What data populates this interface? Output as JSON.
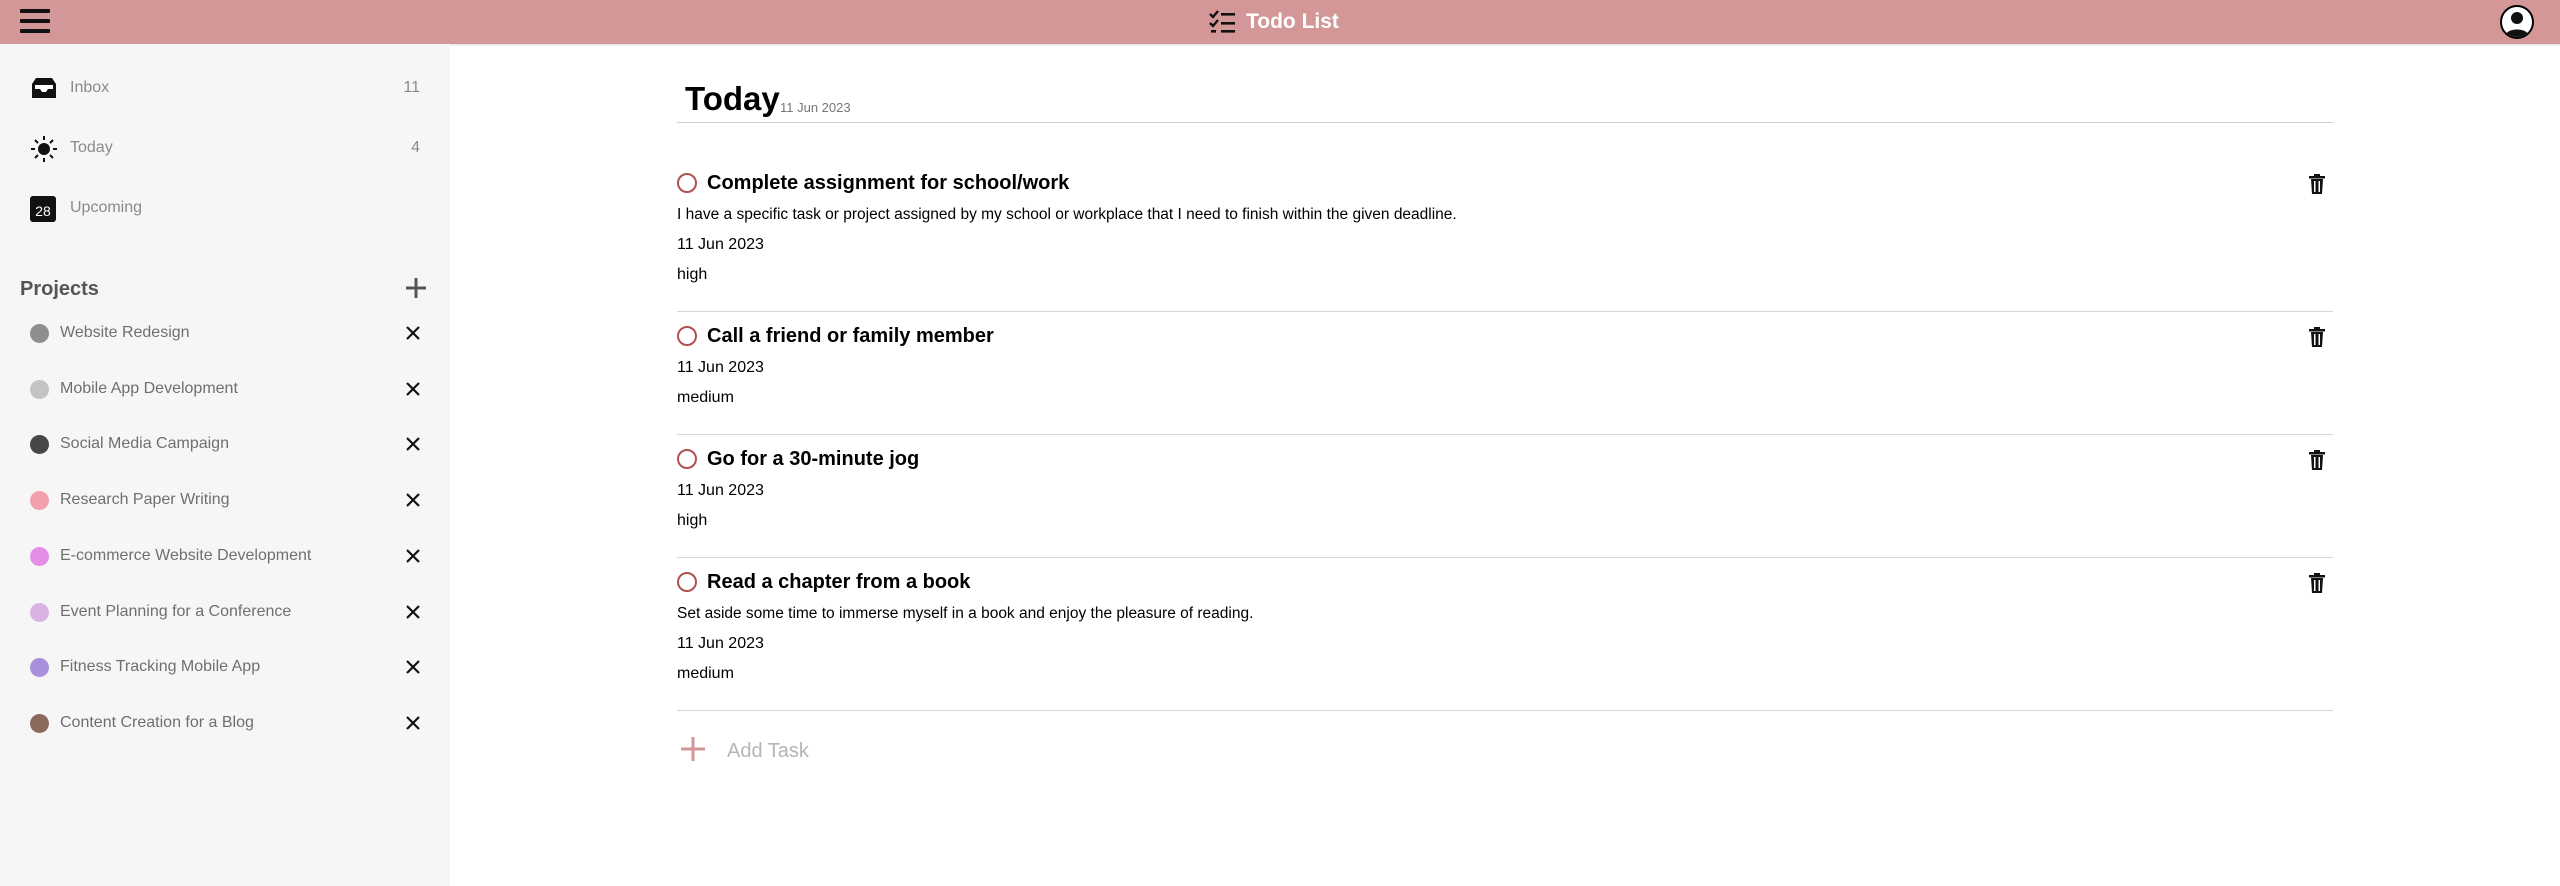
{
  "header": {
    "title": "Todo List",
    "brand_color": "#d39797",
    "menu_icon": "hamburger-icon",
    "brand_icon": "checklist-icon",
    "avatar_icon": "user-avatar-icon"
  },
  "sidebar": {
    "nav": [
      {
        "label": "Inbox",
        "count": "11",
        "icon": "inbox-icon"
      },
      {
        "label": "Today",
        "count": "4",
        "icon": "sun-icon"
      },
      {
        "label": "Upcoming",
        "count": "",
        "icon": "calendar-icon",
        "calendar_day": "28"
      }
    ],
    "projects_title": "Projects",
    "projects": [
      {
        "name": "Website Redesign",
        "color": "#8e8e8e"
      },
      {
        "name": "Mobile App Development",
        "color": "#c4c4c4"
      },
      {
        "name": "Social Media Campaign",
        "color": "#474747"
      },
      {
        "name": "Research Paper Writing",
        "color": "#f2a1ac"
      },
      {
        "name": "E-commerce Website Development",
        "color": "#e58ee8"
      },
      {
        "name": "Event Planning for a Conference",
        "color": "#d9b3e2"
      },
      {
        "name": "Fitness Tracking Mobile App",
        "color": "#a98fdc"
      },
      {
        "name": "Content Creation for a Blog",
        "color": "#8b6a5e"
      }
    ]
  },
  "main": {
    "title": "Today",
    "date": "11 Jun 2023",
    "tasks": [
      {
        "title": "Complete assignment for school/work",
        "description": "I have a specific task or project assigned by my school or workplace that I need to finish within the given deadline.",
        "date": "11 Jun 2023",
        "priority": "high"
      },
      {
        "title": "Call a friend or family member",
        "description": "",
        "date": "11 Jun 2023",
        "priority": "medium"
      },
      {
        "title": "Go for a 30-minute jog",
        "description": "",
        "date": "11 Jun 2023",
        "priority": "high"
      },
      {
        "title": "Read a chapter from a book",
        "description": "Set aside some time to immerse myself in a book and enjoy the pleasure of reading.",
        "date": "11 Jun 2023",
        "priority": "medium"
      }
    ],
    "add_task_label": "Add Task",
    "accent_color": "#b05151"
  }
}
